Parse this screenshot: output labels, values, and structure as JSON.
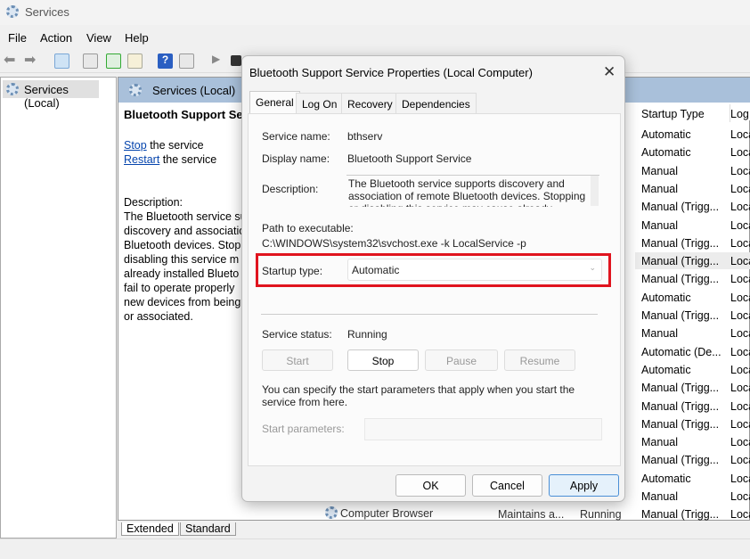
{
  "window": {
    "title": "Services",
    "menu": [
      "File",
      "Action",
      "View",
      "Help"
    ]
  },
  "tree": {
    "root": "Services (Local)"
  },
  "pane": {
    "header": "Services (Local)",
    "service_title": "Bluetooth Support Ser",
    "stop_link": "Stop",
    "stop_rest": " the service",
    "restart_link": "Restart",
    "restart_rest": " the service",
    "description_label": "Description:",
    "description_lines": [
      "The Bluetooth service su",
      "discovery and associatio",
      "Bluetooth devices.  Stop",
      "disabling this service m",
      "already installed Blueto",
      "fail to operate properly",
      "new devices from being",
      "or associated."
    ]
  },
  "list": {
    "columns": {
      "startup_type": "Startup Type",
      "log_on": "Log"
    },
    "rows": [
      [
        "Automatic",
        "Loca"
      ],
      [
        "Automatic",
        "Loca"
      ],
      [
        "Manual",
        "Loca"
      ],
      [
        "Manual",
        "Loca"
      ],
      [
        "Manual (Trigg...",
        "Loca"
      ],
      [
        "Manual",
        "Loca"
      ],
      [
        "Manual (Trigg...",
        "Loca"
      ],
      [
        "Manual (Trigg...",
        "Loca"
      ],
      [
        "Manual (Trigg...",
        "Loca"
      ],
      [
        "Automatic",
        "Loca"
      ],
      [
        "Manual (Trigg...",
        "Loca"
      ],
      [
        "Manual",
        "Loca"
      ],
      [
        "Automatic (De...",
        "Loca"
      ],
      [
        "Automatic",
        "Loca"
      ],
      [
        "Manual (Trigg...",
        "Loca"
      ],
      [
        "Manual (Trigg...",
        "Loca"
      ],
      [
        "Manual (Trigg...",
        "Loca"
      ],
      [
        "Manual",
        "Loca"
      ],
      [
        "Manual (Trigg...",
        "Loca"
      ],
      [
        "Automatic",
        "Loca"
      ],
      [
        "Manual",
        "Loca"
      ]
    ],
    "last_row": {
      "name": "Computer Browser",
      "description": "Maintains a...",
      "status": "Running",
      "startup": "Manual (Trigg...",
      "log": "Loca"
    }
  },
  "bottom_tabs": [
    "Extended",
    "Standard"
  ],
  "dialog": {
    "title": "Bluetooth Support Service Properties (Local Computer)",
    "close": "✕",
    "tabs": [
      "General",
      "Log On",
      "Recovery",
      "Dependencies"
    ],
    "service_name_label": "Service name:",
    "service_name": "bthserv",
    "display_name_label": "Display name:",
    "display_name": "Bluetooth Support Service",
    "description_label": "Description:",
    "description": "The Bluetooth service supports discovery and association of remote Bluetooth devices.  Stopping or disabling this service may cause already installed",
    "path_label": "Path to executable:",
    "path": "C:\\WINDOWS\\system32\\svchost.exe -k LocalService -p",
    "startup_label": "Startup type:",
    "startup_value": "Automatic",
    "status_label": "Service status:",
    "status_value": "Running",
    "buttons": {
      "start": "Start",
      "stop": "Stop",
      "pause": "Pause",
      "resume": "Resume"
    },
    "hint": "You can specify the start parameters that apply when you start the service from here.",
    "params_label": "Start parameters:",
    "ok": "OK",
    "cancel": "Cancel",
    "apply": "Apply"
  },
  "colors": {
    "highlight": "#e0141e",
    "header": "#a9c0da"
  }
}
